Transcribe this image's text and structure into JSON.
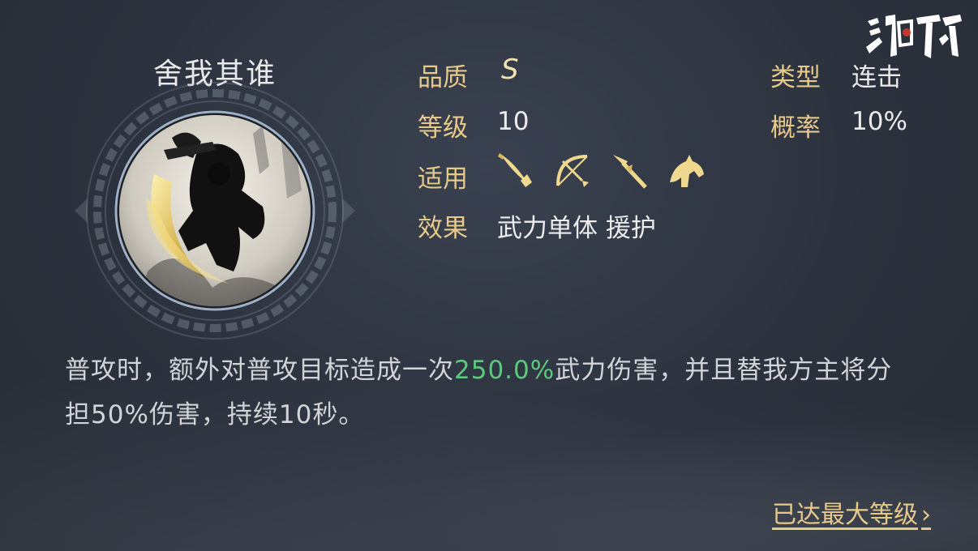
{
  "skill": {
    "name": "舍我其谁",
    "portrait_icon": "warrior-slash-portrait"
  },
  "logo": {
    "text": "鸿图之下",
    "icon": "game-logo"
  },
  "attributes": {
    "quality_label": "品质",
    "quality_value": "S",
    "level_label": "等级",
    "level_value": "10",
    "applicable_label": "适用",
    "applicable_icons": [
      "saber-icon",
      "bow-icon",
      "spear-icon",
      "horse-icon"
    ],
    "effect_label": "效果",
    "effect_value": "武力单体 援护",
    "type_label": "类型",
    "type_value": "连击",
    "chance_label": "概率",
    "chance_value": "10%"
  },
  "description": {
    "part1": "普攻时，额外对普攻目标造成一次",
    "highlight": "250.0%",
    "part2": "武力伤害，并且替我方主将分担50%伤害，持续10秒。"
  },
  "footer": {
    "max_level_label": "已达最大等级",
    "chevron": "›"
  },
  "colors": {
    "label_gold": "#e7c98a",
    "highlight_green": "#5cc97c",
    "background": "#2c323d"
  }
}
